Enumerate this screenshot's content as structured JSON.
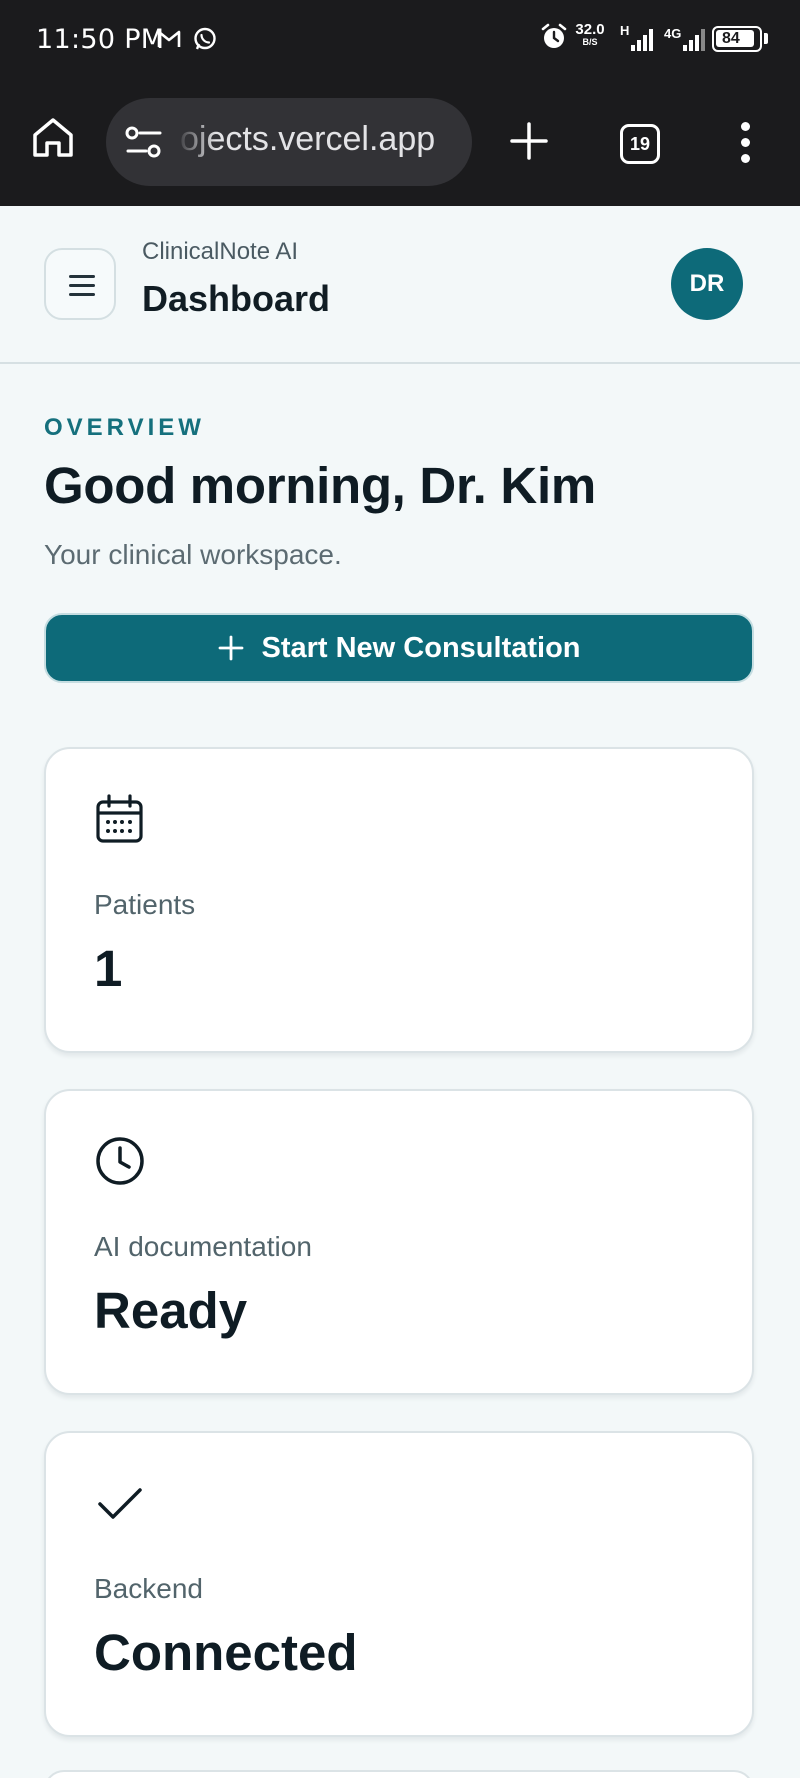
{
  "status_bar": {
    "time": "11:50 PM",
    "network_speed": "32.0",
    "network_speed_unit": "B/S",
    "network_type": "4G",
    "sim_label": "H",
    "battery": "84"
  },
  "browser": {
    "url": "ojects.vercel.app",
    "tab_count": "19"
  },
  "header": {
    "brand": "ClinicalNote AI",
    "title": "Dashboard",
    "avatar_initials": "DR"
  },
  "main": {
    "overline": "OVERVIEW",
    "greeting": "Good morning, Dr. Kim",
    "subtitle": "Your clinical workspace.",
    "primary_action": "Start New Consultation",
    "cards": [
      {
        "icon": "calendar-icon",
        "label": "Patients",
        "value": "1"
      },
      {
        "icon": "clock-icon",
        "label": "AI documentation",
        "value": "Ready"
      },
      {
        "icon": "check-icon",
        "label": "Backend",
        "value": "Connected"
      }
    ]
  },
  "colors": {
    "accent": "#0d6a79",
    "background": "#f3f8f9",
    "card": "#ffffff",
    "overline": "#15707d"
  }
}
